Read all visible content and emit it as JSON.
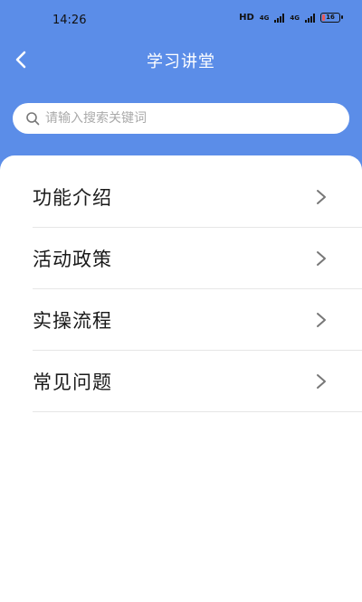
{
  "status_bar": {
    "time": "14:26",
    "network_label": "HD",
    "signal_1_label": "4G",
    "signal_2_label": "4G",
    "battery_level": "16",
    "battery_color": "#e85b5b"
  },
  "header": {
    "title": "学习讲堂",
    "background_color": "#5b8de8"
  },
  "search": {
    "placeholder": "请输入搜索关键词",
    "value": ""
  },
  "menu": {
    "items": [
      {
        "label": "功能介绍",
        "icon": "chevron-right-icon"
      },
      {
        "label": "活动政策",
        "icon": "chevron-right-icon"
      },
      {
        "label": "实操流程",
        "icon": "chevron-right-icon"
      },
      {
        "label": "常见问题",
        "icon": "chevron-right-icon"
      }
    ]
  }
}
